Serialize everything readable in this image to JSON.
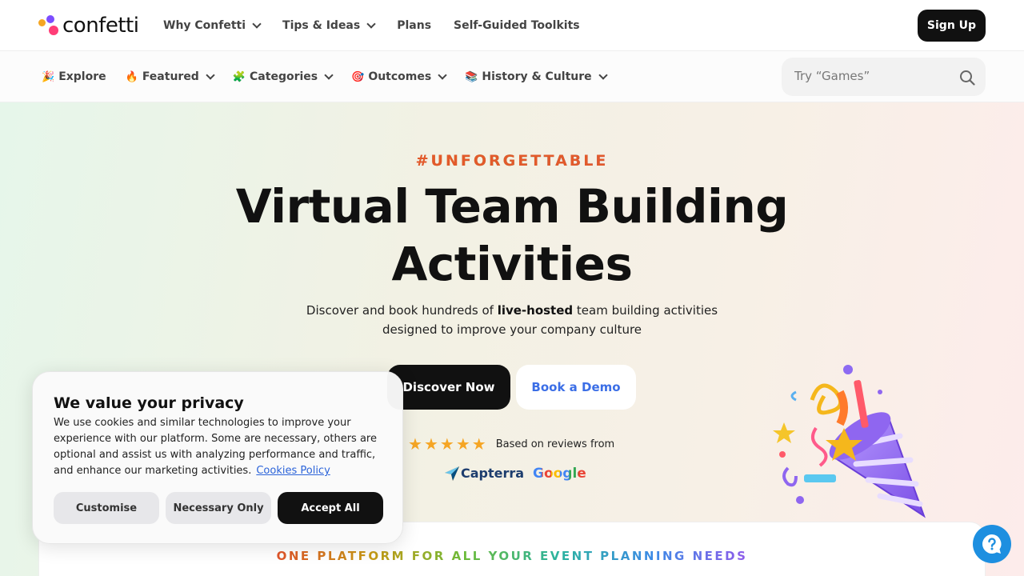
{
  "brand": {
    "name": "confetti"
  },
  "topnav": {
    "items": [
      {
        "label": "Why Confetti",
        "dropdown": true
      },
      {
        "label": "Tips & Ideas",
        "dropdown": true
      },
      {
        "label": "Plans",
        "dropdown": false
      },
      {
        "label": "Self-Guided Toolkits",
        "dropdown": false
      }
    ],
    "signup_label": "Sign Up"
  },
  "subnav": {
    "items": [
      {
        "emoji": "🎉",
        "label": "Explore",
        "dropdown": false
      },
      {
        "emoji": "🔥",
        "label": "Featured",
        "dropdown": true
      },
      {
        "emoji": "🧩",
        "label": "Categories",
        "dropdown": true
      },
      {
        "emoji": "🎯",
        "label": "Outcomes",
        "dropdown": true
      },
      {
        "emoji": "📚",
        "label": "History & Culture",
        "dropdown": true
      }
    ],
    "search_placeholder": "Try “Games”"
  },
  "hero": {
    "tagline": "#UNFORGETTABLE",
    "title_line1": "Virtual Team Building",
    "title_line2": "Activities",
    "sub_pre": "Discover and book hundreds of ",
    "sub_bold": "live-hosted",
    "sub_post": " team building activities",
    "sub_line2": "designed to improve your company culture",
    "discover_label": "Discover Now",
    "demo_label": "Book a Demo",
    "rating_stars": 5,
    "reviews_text": "Based on reviews from",
    "capterra": "Capterra",
    "google": "Google"
  },
  "section": {
    "heading": "ONE PLATFORM FOR ALL YOUR EVENT PLANNING NEEDS"
  },
  "cookie": {
    "title": "We value your privacy",
    "body": "We use cookies and similar technologies to improve your experience with our platform. Some are necessary, others are optional and assist us with analyzing performance and traffic, and enhance our marketing activities.",
    "policy_link": "Cookies Policy",
    "customise": "Customise",
    "necessary": "Necessary Only",
    "accept": "Accept All"
  },
  "colors": {
    "accent_blue": "#3b6ee6",
    "help_blue": "#1d8fe0",
    "star": "#f5a524"
  }
}
